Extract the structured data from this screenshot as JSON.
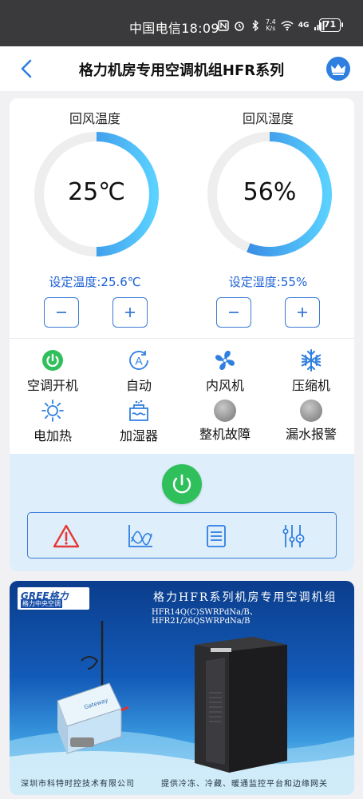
{
  "status_bar": {
    "carrier": "中国电信",
    "time": "18:09",
    "net_speed_value": "7.4",
    "net_speed_unit": "K/s",
    "network_type": "4G",
    "battery": "71"
  },
  "header": {
    "title": "格力机房专用空调机组HFR系列"
  },
  "temperature": {
    "label": "回风温度",
    "value": "25℃",
    "fill_fraction": 0.5,
    "setpoint": "设定温度:25.6℃"
  },
  "humidity": {
    "label": "回风湿度",
    "value": "56%",
    "fill_fraction": 0.56,
    "setpoint": "设定湿度:55%"
  },
  "status_items": [
    {
      "label": "空调开机",
      "icon": "power-on-icon",
      "active": true
    },
    {
      "label": "自动",
      "icon": "auto-mode-icon",
      "active": true
    },
    {
      "label": "内风机",
      "icon": "fan-icon",
      "active": true
    },
    {
      "label": "压缩机",
      "icon": "snowflake-icon",
      "active": true
    },
    {
      "label": "电加热",
      "icon": "heater-sun-icon",
      "active": true
    },
    {
      "label": "加湿器",
      "icon": "humidifier-icon",
      "active": true
    },
    {
      "label": "整机故障",
      "icon": "fault-indicator-icon",
      "active": false
    },
    {
      "label": "漏水报警",
      "icon": "leak-alarm-indicator-icon",
      "active": false
    }
  ],
  "tools": [
    {
      "icon": "alarm-warning-icon"
    },
    {
      "icon": "trend-chart-icon"
    },
    {
      "icon": "log-list-icon"
    },
    {
      "icon": "settings-sliders-icon"
    }
  ],
  "banner": {
    "logo_text": "GREE格力",
    "logo_sub": "格力中央空调",
    "title": "格力HFR系列机房专用空调机组",
    "models": "HFR14Q(C)SWRPdNa/B、HFR21/26QSWRPdNa/B",
    "gateway_label": "Gateway",
    "company": "深圳市科特时控技术有限公司",
    "slogan": "提供冷冻、冷藏、暖通监控平台和边缘网关"
  },
  "colors": {
    "accent": "#1a5fd6",
    "gauge_start": "#2a6fd9",
    "gauge_end": "#5ad1ff",
    "power_green": "#2fc05b",
    "alarm_red": "#e53935",
    "control_bg": "#deeffb"
  }
}
